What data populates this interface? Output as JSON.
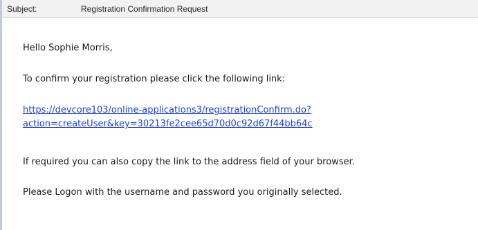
{
  "header": {
    "subject_label": "Subject:",
    "subject_value": "Registration Confirmation Request"
  },
  "message": {
    "greeting": "Hello Sophie Morris,",
    "instruction": "To confirm your registration please click the following link:",
    "link_line1": "https://devcore103/online-applications3/registrationConfirm.do?",
    "link_line2": "action=createUser&key=30213fe2cee65d70d0c92d67f44bb64c",
    "copy_hint": "If required you can also copy the link to the address field of your browser.",
    "logon_hint": "Please Logon with the username and password you originally selected."
  },
  "colors": {
    "link": "#1f3fd6",
    "header_bg": "#f2f2f2",
    "text": "#1a1a1a"
  }
}
